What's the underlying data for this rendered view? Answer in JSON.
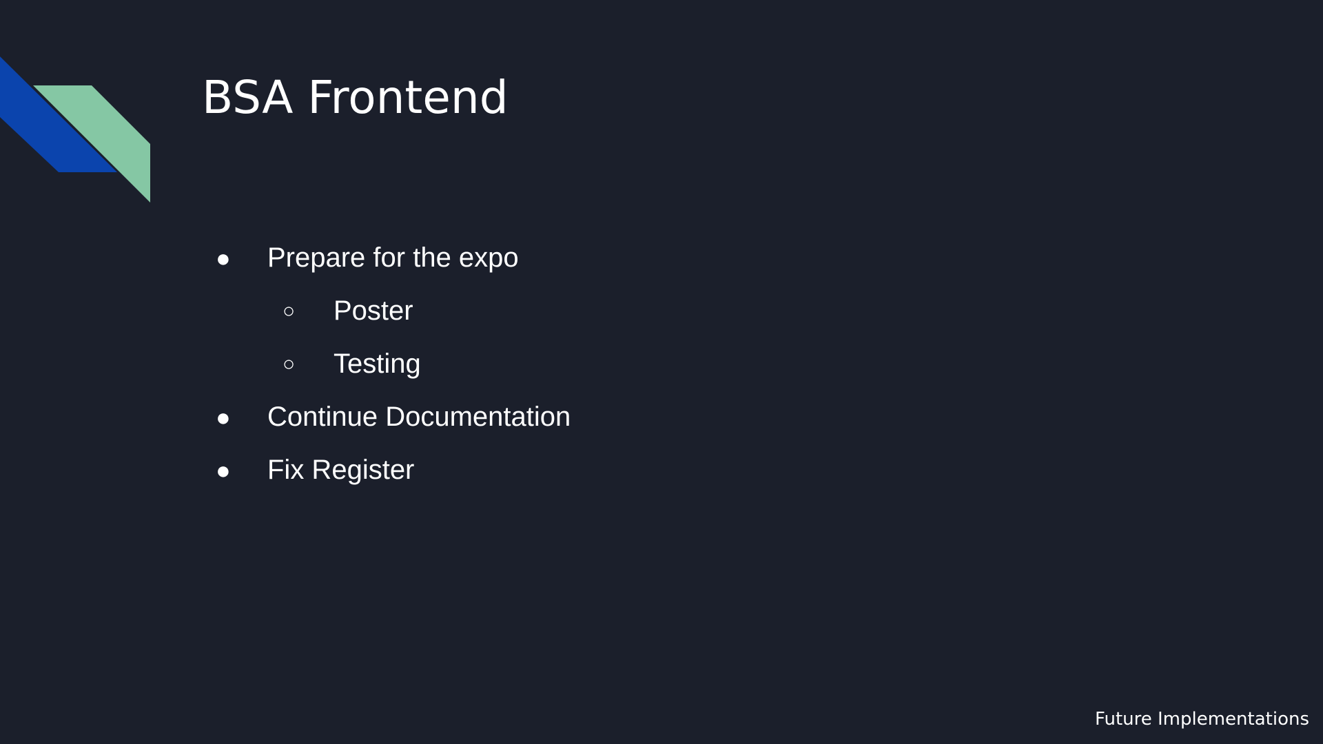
{
  "slide": {
    "title": "BSA Frontend",
    "footer": "Future Implementations",
    "colors": {
      "background": "#1b1f2b",
      "text": "#ffffff",
      "accent_blue": "#0b44ad",
      "accent_green": "#85c7a4"
    },
    "bullets": [
      {
        "marker": "●",
        "text": "Prepare for the expo",
        "level": 1
      },
      {
        "marker": "○",
        "text": "Poster",
        "level": 2
      },
      {
        "marker": "○",
        "text": "Testing",
        "level": 2
      },
      {
        "marker": "●",
        "text": "Continue Documentation",
        "level": 1
      },
      {
        "marker": "●",
        "text": "Fix Register",
        "level": 1
      }
    ]
  }
}
